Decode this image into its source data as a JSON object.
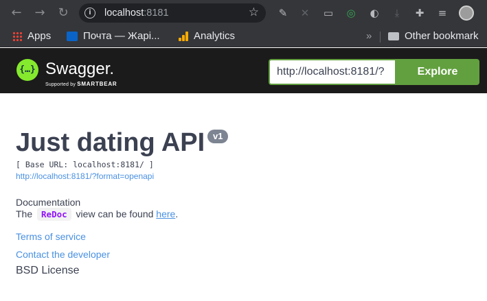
{
  "browser": {
    "url_host": "localhost",
    "url_port": ":8181",
    "bookmarks": [
      {
        "label": "Apps"
      },
      {
        "label": "Почта — Жарі..."
      },
      {
        "label": "Analytics"
      }
    ],
    "bookmarks_overflow": "»",
    "other_bookmarks": "Other bookmark"
  },
  "swagger": {
    "logo_text": "Swagger.",
    "logo_sub": "Supported by",
    "logo_sub_brand": "SMARTBEAR",
    "url_value": "http://localhost:8181/?",
    "explore_label": "Explore"
  },
  "info": {
    "title": "Just dating API",
    "version": "v1",
    "base_url": "[ Base URL: localhost:8181/ ]",
    "spec_link": "http://localhost:8181/?format=openapi",
    "doc_heading": "Documentation",
    "doc_prefix": "The",
    "redoc": "ReDoc",
    "doc_middle": "view can be found",
    "doc_link": "here",
    "doc_suffix": ".",
    "terms": "Terms of service",
    "contact": "Contact the developer",
    "license": "BSD License"
  },
  "colors": {
    "swagger_green": "#62a03f",
    "topbar": "#1b1b1b",
    "link": "#4990e2",
    "title": "#3b4151",
    "redoc": "#9012fe"
  }
}
